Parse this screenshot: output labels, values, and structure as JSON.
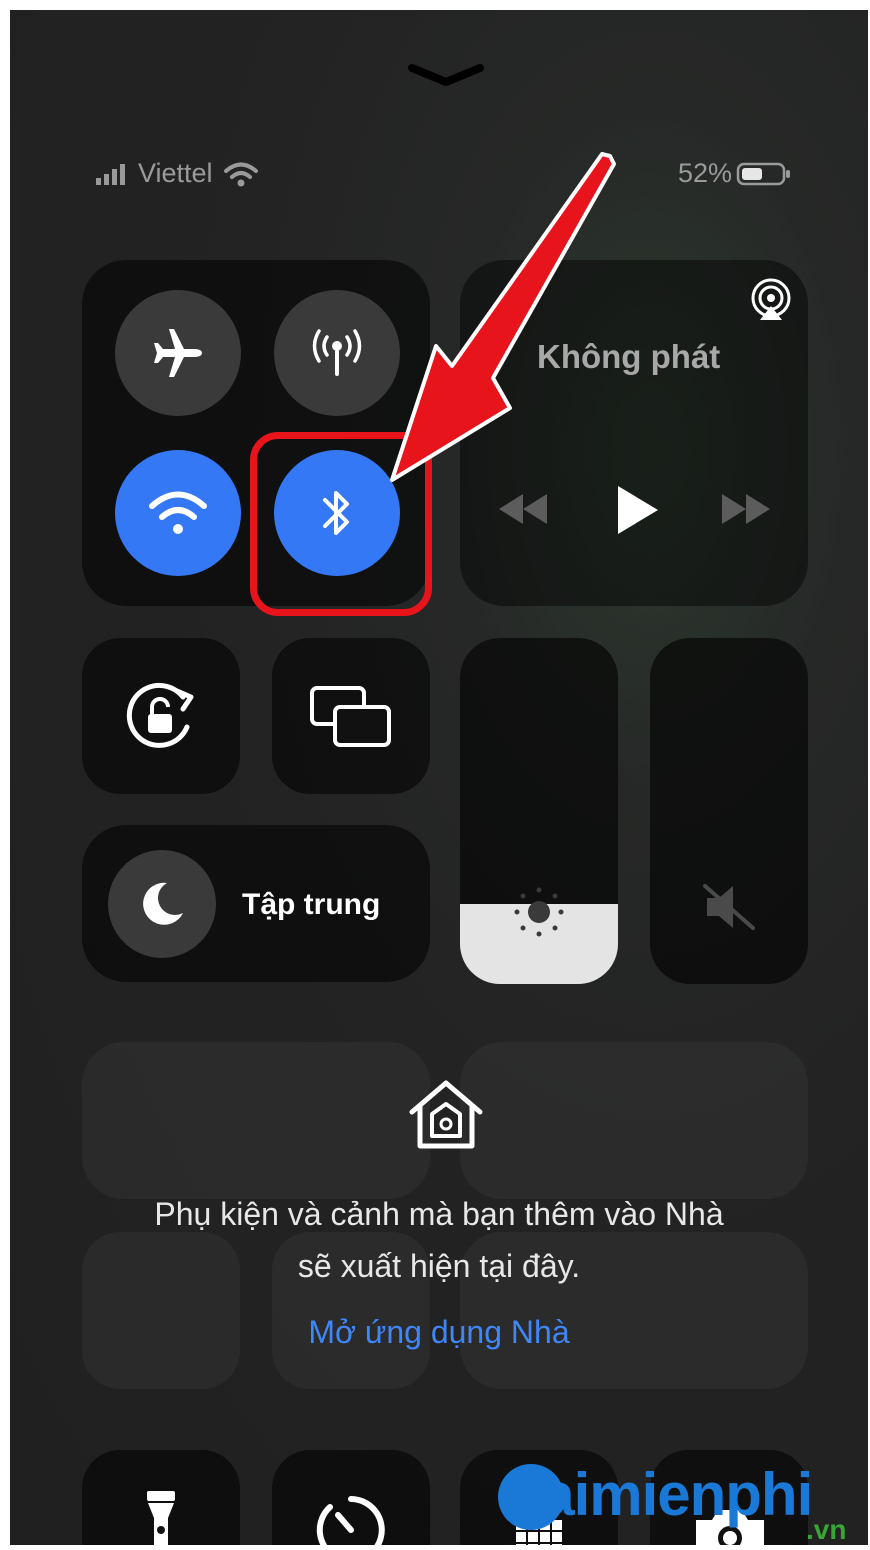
{
  "status_bar": {
    "carrier": "Viettel",
    "battery_percent": "52%"
  },
  "media": {
    "now_playing": "Không phát"
  },
  "focus": {
    "label": "Tập trung"
  },
  "home": {
    "message_line1": "Phụ kiện và cảnh mà bạn thêm vào Nhà",
    "message_line2": "sẽ xuất hiện tại đây.",
    "open_link": "Mở ứng dụng Nhà"
  },
  "watermark": {
    "brand": "Taimienphi",
    "suffix": ".vn"
  },
  "colors": {
    "accent_blue": "#3478f6",
    "highlight_red": "#e8141c"
  },
  "levels": {
    "brightness": 0.23,
    "volume": 0.0
  }
}
